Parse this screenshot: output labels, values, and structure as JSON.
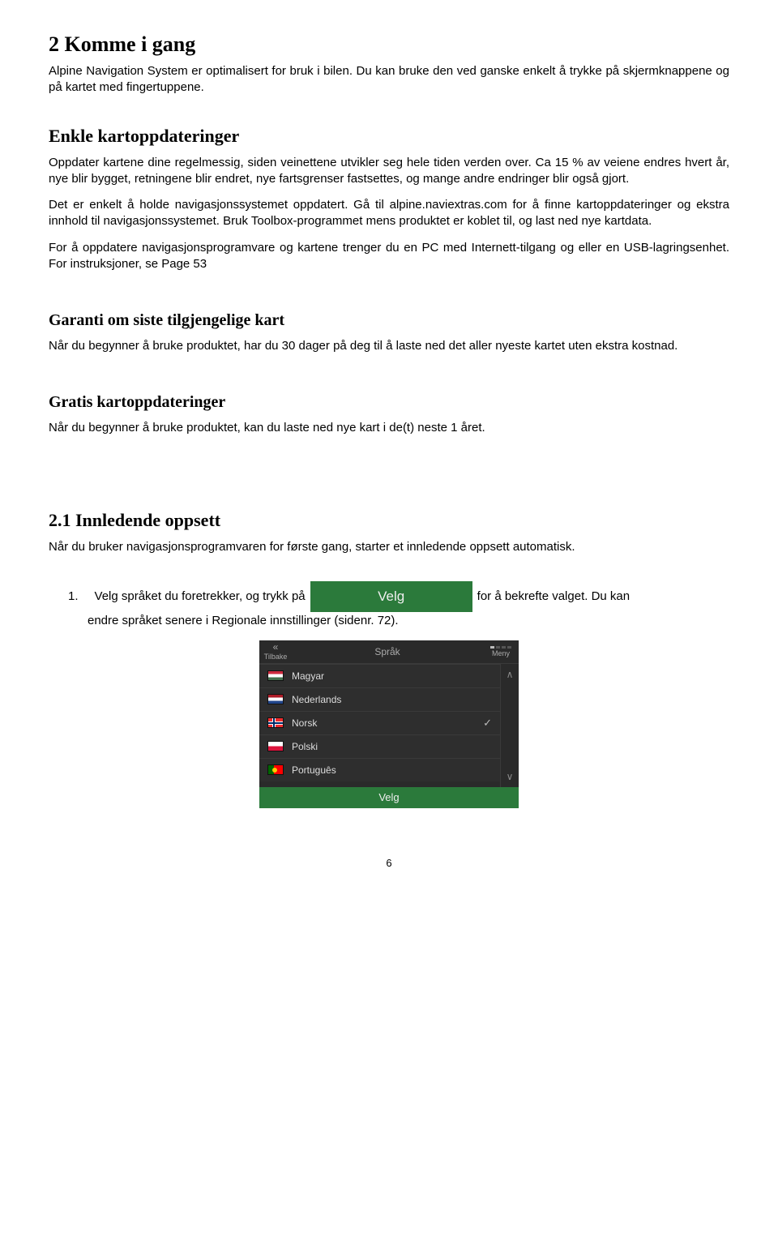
{
  "h1": "2 Komme i gang",
  "intro": "Alpine Navigation System er optimalisert for bruk i bilen. Du kan bruke den ved ganske enkelt å trykke på skjermknappene og på kartet med fingertuppene.",
  "sections": {
    "enkle": {
      "title": "Enkle kartoppdateringer",
      "p1": "Oppdater kartene dine regelmessig, siden veinettene utvikler seg hele tiden verden over. Ca 15 % av veiene endres hvert år, nye blir bygget, retningene blir endret, nye fartsgrenser fastsettes, og mange andre endringer blir også gjort.",
      "p2": "Det er enkelt å holde navigasjonssystemet oppdatert. Gå til alpine.naviextras.com for å finne kartoppdateringer og ekstra innhold til navigasjonssystemet. Bruk Toolbox-programmet mens produktet er koblet til, og last ned nye kartdata.",
      "p3": "For å oppdatere navigasjonsprogramvare og kartene trenger du en PC med Internett-tilgang og  eller en USB-lagringsenhet. For instruksjoner, se Page 53"
    },
    "garanti": {
      "title": "Garanti om siste tilgjengelige kart",
      "p1": "Når du begynner å bruke produktet, har du 30 dager på deg til å laste ned det aller nyeste kartet uten ekstra kostnad."
    },
    "gratis": {
      "title": "Gratis kartoppdateringer",
      "p1": "Når du begynner å bruke produktet, kan du laste ned nye kart i de(t) neste  1 året."
    },
    "innledende": {
      "title": "2.1 Innledende oppsett",
      "p1": "Når du bruker navigasjonsprogramvaren for første gang, starter et innledende oppsett automatisk.",
      "step_num": "1.",
      "step_pre": "Velg språket du foretrekker, og trykk på",
      "step_btn": "Velg",
      "step_post": "for å bekrefte valget. Du kan",
      "step_tail": "endre språket senere i Regionale innstillinger (sidenr. 72)."
    }
  },
  "lang_widget": {
    "back_label": "Tilbake",
    "title": "Språk",
    "menu_label": "Meny",
    "items": [
      {
        "flag": "hu",
        "label": "Magyar"
      },
      {
        "flag": "nl",
        "label": "Nederlands"
      },
      {
        "flag": "no",
        "label": "Norsk",
        "selected": true
      },
      {
        "flag": "pl",
        "label": "Polski"
      },
      {
        "flag": "pt",
        "label": "Português"
      }
    ],
    "footer": "Velg"
  },
  "page_number": "6"
}
